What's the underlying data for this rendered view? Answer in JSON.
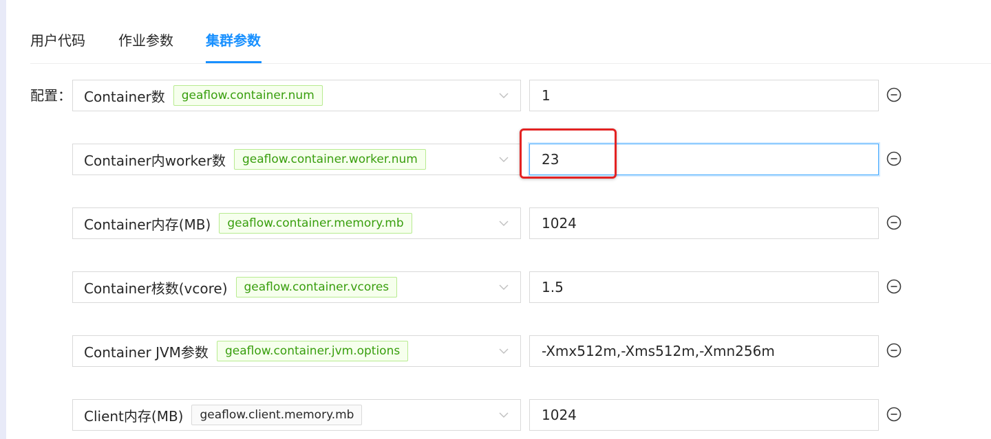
{
  "tabs": [
    {
      "label": "用户代码",
      "active": false
    },
    {
      "label": "作业参数",
      "active": false
    },
    {
      "label": "集群参数",
      "active": true
    }
  ],
  "config_label": "配置：",
  "rows": [
    {
      "label": "Container数",
      "key": "geaflow.container.num",
      "value": "1",
      "tag_color": "green"
    },
    {
      "label": "Container内worker数",
      "key": "geaflow.container.worker.num",
      "value": "23",
      "tag_color": "green",
      "focused": true
    },
    {
      "label": "Container内存(MB)",
      "key": "geaflow.container.memory.mb",
      "value": "1024",
      "tag_color": "green"
    },
    {
      "label": "Container核数(vcore)",
      "key": "geaflow.container.vcores",
      "value": "1.5",
      "tag_color": "green"
    },
    {
      "label": "Container JVM参数",
      "key": "geaflow.container.jvm.options",
      "value": "-Xmx512m,-Xms512m,-Xmn256m",
      "tag_color": "green"
    },
    {
      "label": "Client内存(MB)",
      "key": "geaflow.client.memory.mb",
      "value": "1024",
      "tag_color": "default"
    }
  ],
  "icons": {
    "select_arrow": "chevron-down-icon",
    "remove": "minus-circle-icon"
  },
  "colors": {
    "accent": "#1890ff",
    "tag_green_text": "#389e0d",
    "tag_green_border": "#b7eb8f",
    "tag_green_bg": "#f6ffed",
    "annotation": "#e32222"
  }
}
